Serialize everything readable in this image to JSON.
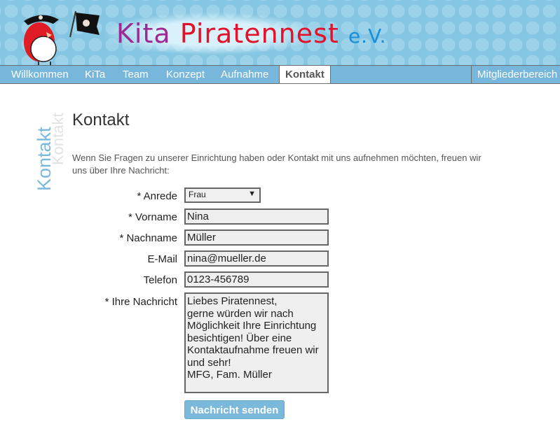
{
  "header": {
    "logo": {
      "part1": "Kita",
      "part2": "Piratennest",
      "part3": "e.V."
    }
  },
  "nav": {
    "items": [
      {
        "label": "Willkommen"
      },
      {
        "label": "KiTa"
      },
      {
        "label": "Team"
      },
      {
        "label": "Konzept"
      },
      {
        "label": "Aufnahme"
      },
      {
        "label": "Kontakt",
        "active": true
      }
    ],
    "members": "Mitgliederbereich"
  },
  "sidebar": {
    "title": "Kontakt",
    "shadow": "Kontakt"
  },
  "page": {
    "title": "Kontakt",
    "intro": "Wenn Sie Fragen zu unserer Einrichtung haben oder Kontakt mit uns aufnehmen möchten, freuen wir uns über Ihre Nachricht:"
  },
  "form": {
    "anrede": {
      "label": "* Anrede",
      "value": "Frau"
    },
    "vorname": {
      "label": "* Vorname",
      "value": "Nina"
    },
    "nachname": {
      "label": "* Nachname",
      "value": "Müller"
    },
    "email": {
      "label": "E-Mail",
      "value": "nina@mueller.de"
    },
    "telefon": {
      "label": "Telefon",
      "value": "0123-456789"
    },
    "nachricht": {
      "label": "* Ihre Nachricht",
      "value": "Liebes Piratennest,\ngerne würden wir nach Möglichkeit Ihre Einrichtung besichtigen! Über eine Kontaktaufnahme freuen wir und sehr!\nMFG, Fam. Müller"
    },
    "submit": "Nachricht senden"
  },
  "colors": {
    "accent": "#7ab8dc",
    "header_bg": "#85c6e2"
  }
}
